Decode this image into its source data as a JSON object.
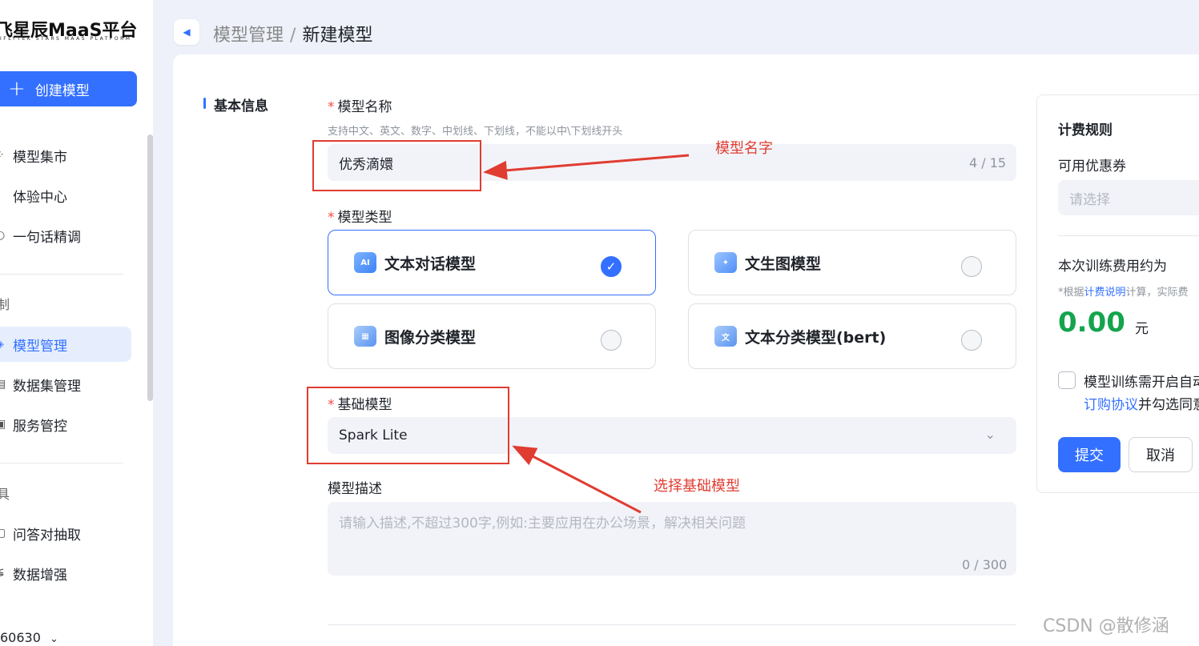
{
  "sidebar": {
    "logo": "飞星辰MaaS平台",
    "logo_sub": "IFLYTEK STARS MAAS PLATFORM",
    "create_button": "创建模型",
    "items": [
      {
        "label": "模型集市",
        "icon": "grid-icon"
      },
      {
        "label": "体验中心",
        "icon": "experience-icon"
      },
      {
        "label": "一句话精调",
        "icon": "chat-tune-icon"
      }
    ],
    "group_train": "制",
    "train_items": [
      {
        "label": "模型管理",
        "icon": "model-icon",
        "active": true
      },
      {
        "label": "数据集管理",
        "icon": "dataset-icon"
      },
      {
        "label": "服务管控",
        "icon": "service-icon"
      }
    ],
    "group_tools": "具",
    "tool_items": [
      {
        "label": "问答对抽取",
        "icon": "qa-icon"
      },
      {
        "label": "数据增强",
        "icon": "enhance-icon"
      }
    ],
    "user": "60630"
  },
  "header": {
    "crumb_parent": "模型管理",
    "crumb_sep": "/",
    "crumb_current": "新建模型"
  },
  "form": {
    "section_title": "基本信息",
    "name_label": "模型名称",
    "name_hint": "支持中文、英文、数字、中划线、下划线，不能以中\\下划线开头",
    "name_value": "优秀滴嬛",
    "name_count": "4 / 15",
    "type_label": "模型类型",
    "types": [
      {
        "label": "文本对话模型",
        "selected": true,
        "icon": "chat-ai-icon"
      },
      {
        "label": "文生图模型",
        "selected": false,
        "icon": "image-gen-icon"
      },
      {
        "label": "图像分类模型",
        "selected": false,
        "icon": "image-class-icon"
      },
      {
        "label": "文本分类模型(bert)",
        "selected": false,
        "icon": "text-class-icon"
      }
    ],
    "base_label": "基础模型",
    "base_value": "Spark Lite",
    "desc_label": "模型描述",
    "desc_placeholder": "请输入描述,不超过300字,例如:主要应用在办公场景，解决相关问题",
    "desc_count": "0 / 300"
  },
  "annotations": {
    "name_note": "模型名字",
    "base_note": "选择基础模型",
    "color": "#e03c31"
  },
  "billing": {
    "title": "计费规则",
    "coupon_label": "可用优惠券",
    "coupon_placeholder": "请选择",
    "fee_label": "本次训练费用约为",
    "note_prefix": "*根据",
    "note_link": "计费说明",
    "note_suffix": "计算，实际费",
    "price": "0.00",
    "unit": "元",
    "agree_line1": "模型训练需开启自动",
    "agree_link": "订购协议",
    "agree_line2": "并勾选同意",
    "submit": "提交",
    "cancel": "取消"
  },
  "watermark": "CSDN @散修涵",
  "colors": {
    "accent": "#3370ff",
    "price": "#14a44d",
    "required": "#f54a45"
  }
}
